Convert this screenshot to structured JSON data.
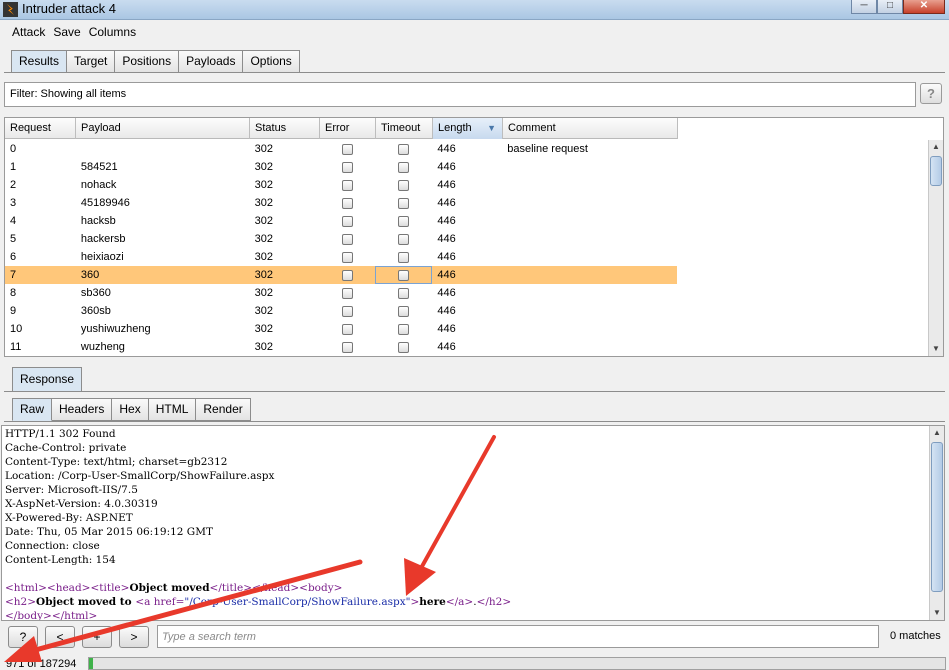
{
  "window": {
    "title": "Intruder attack 4"
  },
  "menu": [
    "Attack",
    "Save",
    "Columns"
  ],
  "top_tabs": [
    "Results",
    "Target",
    "Positions",
    "Payloads",
    "Options"
  ],
  "filter": {
    "text": "Filter: Showing all items"
  },
  "help_label": "?",
  "table": {
    "columns": [
      "Request",
      "Payload",
      "Status",
      "Error",
      "Timeout",
      "Length",
      "Comment"
    ],
    "sorted_column": "Length",
    "rows": [
      {
        "request": "0",
        "payload": "",
        "status": "302",
        "error": false,
        "timeout": false,
        "length": "446",
        "comment": "baseline request"
      },
      {
        "request": "1",
        "payload": "584521",
        "status": "302",
        "error": false,
        "timeout": false,
        "length": "446",
        "comment": ""
      },
      {
        "request": "2",
        "payload": "nohack",
        "status": "302",
        "error": false,
        "timeout": false,
        "length": "446",
        "comment": ""
      },
      {
        "request": "3",
        "payload": "45189946",
        "status": "302",
        "error": false,
        "timeout": false,
        "length": "446",
        "comment": ""
      },
      {
        "request": "4",
        "payload": "hacksb",
        "status": "302",
        "error": false,
        "timeout": false,
        "length": "446",
        "comment": ""
      },
      {
        "request": "5",
        "payload": "hackersb",
        "status": "302",
        "error": false,
        "timeout": false,
        "length": "446",
        "comment": ""
      },
      {
        "request": "6",
        "payload": "heixiaozi",
        "status": "302",
        "error": false,
        "timeout": false,
        "length": "446",
        "comment": ""
      },
      {
        "request": "7",
        "payload": "360",
        "status": "302",
        "error": false,
        "timeout": false,
        "length": "446",
        "comment": "",
        "selected": true
      },
      {
        "request": "8",
        "payload": "sb360",
        "status": "302",
        "error": false,
        "timeout": false,
        "length": "446",
        "comment": ""
      },
      {
        "request": "9",
        "payload": "360sb",
        "status": "302",
        "error": false,
        "timeout": false,
        "length": "446",
        "comment": ""
      },
      {
        "request": "10",
        "payload": "yushiwuzheng",
        "status": "302",
        "error": false,
        "timeout": false,
        "length": "446",
        "comment": ""
      },
      {
        "request": "11",
        "payload": "wuzheng",
        "status": "302",
        "error": false,
        "timeout": false,
        "length": "446",
        "comment": ""
      }
    ]
  },
  "response_tab": "Response",
  "view_tabs": [
    "Raw",
    "Headers",
    "Hex",
    "HTML",
    "Render"
  ],
  "response": {
    "headers": [
      "HTTP/1.1 302 Found",
      "Cache-Control: private",
      "Content-Type: text/html; charset=gb2312",
      "Location: /Corp-User-SmallCorp/ShowFailure.aspx",
      "Server: Microsoft-IIS/7.5",
      "X-AspNet-Version: 4.0.30319",
      "X-Powered-By: ASP.NET",
      "Date: Thu, 05 Mar 2015 06:19:12 GMT",
      "Connection: close",
      "Content-Length: 154"
    ],
    "body": {
      "t_html": "<html>",
      "t_head": "<head>",
      "t_title": "<title>",
      "title_text": "Object moved",
      "t_title_end": "</title>",
      "t_head_end": "</head>",
      "t_body": "<body>",
      "t_h2": "<h2>",
      "h2_text": "Object moved to ",
      "t_a_open": "<a href=",
      "href": "\"/Corp-User-SmallCorp/ShowFailure.aspx\"",
      "t_gt": ">",
      "here": "here",
      "t_a_end": "</a>",
      "dot": ".",
      "t_h2_end": "</h2>",
      "t_body_end": "</body>",
      "t_html_end": "</html>"
    }
  },
  "search": {
    "help_label": "?",
    "prev_label": "<",
    "add_label": "+",
    "next_label": ">",
    "placeholder": "Type a search term",
    "matches": "0 matches"
  },
  "status": {
    "progress_text": "971 of 187294",
    "progress_fraction": 0.0052
  },
  "colors": {
    "selected_row": "#ffc77a",
    "annotation": "#e8392b",
    "tab_active": "#d9e6f2"
  }
}
